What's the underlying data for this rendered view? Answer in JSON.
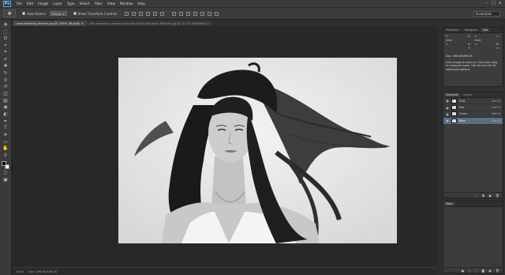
{
  "app": {
    "logo": "Ps",
    "menu": [
      "File",
      "Edit",
      "Image",
      "Layer",
      "Type",
      "Select",
      "Filter",
      "View",
      "Window",
      "Help"
    ],
    "window_controls": [
      "–",
      "□",
      "×"
    ]
  },
  "options": {
    "auto_select_label": "Auto-Select:",
    "auto_select_value": "Group",
    "show_transform_label": "Show Transform Controls",
    "workspace": "Essentials"
  },
  "tabs": [
    {
      "label": "Lana Modeling Behon.jpg @ 100% (Blue/8)",
      "active": true
    },
    {
      "label": "Ella-avezone-camera-presents-daily-nafi-open-flaterm.jpg @ 33.3% (RGB/8#)",
      "active": false
    }
  ],
  "tools": [
    "move-tool",
    "marquee-tool",
    "lasso-tool",
    "quick-select-tool",
    "crop-tool",
    "eyedropper-tool",
    "spot-heal-tool",
    "brush-tool",
    "clone-stamp-tool",
    "history-brush-tool",
    "eraser-tool",
    "gradient-tool",
    "blur-tool",
    "dodge-tool",
    "pen-tool",
    "type-tool",
    "path-select-tool",
    "shape-tool",
    "hand-tool",
    "zoom-tool"
  ],
  "tool_glyphs": [
    "✥",
    "⬚",
    "ʘ",
    "⌖",
    "⌗",
    "✐",
    "✚",
    "✎",
    "⚲",
    "↺",
    "◫",
    "▤",
    "◉",
    "◐",
    "✒",
    "T",
    "➤",
    "▭",
    "✋",
    "⚲"
  ],
  "colors": {
    "foreground": "#000000",
    "background": "#ffffff"
  },
  "info_panel": {
    "tabs": [
      "Properties",
      "Histogram",
      "Info"
    ],
    "rows": [
      [
        "K :",
        "C :"
      ],
      [
        "8-bit",
        "8-bit"
      ],
      [
        "X :",
        "W :"
      ],
      [
        "Y :",
        "H :"
      ]
    ],
    "doc": "Doc: 496.4K/496.4K",
    "help": "Click image to zoom in. Click and drag to marquee zoom. Use Alt and Ctrl for additional options."
  },
  "channels_panel": {
    "tabs": [
      "Channels",
      "Layers"
    ],
    "channels": [
      {
        "name": "RGB",
        "key": "Ctrl+2",
        "selected": false,
        "visible": true
      },
      {
        "name": "Red",
        "key": "Ctrl+3",
        "selected": false,
        "visible": true
      },
      {
        "name": "Green",
        "key": "Ctrl+4",
        "selected": false,
        "visible": true
      },
      {
        "name": "Blue",
        "key": "Ctrl+5",
        "selected": true,
        "visible": true
      }
    ],
    "footer_icons": [
      "dotted-circle-icon",
      "save-selection-icon",
      "new-channel-icon",
      "delete-icon"
    ]
  },
  "paths_panel": {
    "tabs": [
      "Paths"
    ],
    "footer_icons": [
      "fill-icon",
      "stroke-icon",
      "load-icon",
      "mask-icon",
      "new-path-icon",
      "delete-icon"
    ]
  },
  "status": {
    "zoom": "100%",
    "doc": "Doc: 496.4K/496.4K"
  }
}
